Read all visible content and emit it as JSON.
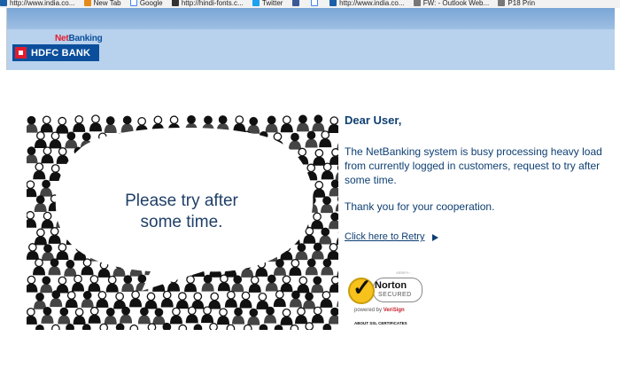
{
  "bookmarks": [
    {
      "label": "http://www.india.co...",
      "icon": "linkedin-icon"
    },
    {
      "label": "New Tab",
      "icon": "new-tab-icon"
    },
    {
      "label": "Google",
      "icon": "google-icon"
    },
    {
      "label": "http://hindi-fonts.c...",
      "icon": "hindi-fonts-icon"
    },
    {
      "label": "Twitter",
      "icon": "twitter-icon"
    },
    {
      "label": "",
      "icon": "facebook-icon"
    },
    {
      "label": "",
      "icon": "google-icon"
    },
    {
      "label": "http://www.india.co...",
      "icon": "linkedin-icon"
    },
    {
      "label": "FW: - Outlook Web...",
      "icon": "outlook-icon"
    },
    {
      "label": "P18 Prin",
      "icon": "globe-icon"
    }
  ],
  "header": {
    "brand_net": "Net",
    "brand_banking": "Banking",
    "brand_name": "HDFC BANK"
  },
  "image": {
    "message": "Please try after some time."
  },
  "message": {
    "greeting": "Dear User,",
    "body": "The NetBanking system is busy processing heavy load from currently logged in customers, request to try after some time.",
    "thanks": "Thank you for your cooperation.",
    "retry_link": "Click here to Retry"
  },
  "norton": {
    "verify": "VERIFY›",
    "name": "Norton",
    "secured": "SECURED",
    "powered_by": "powered by",
    "verisign": "VeriSign",
    "about": "ABOUT SSL CERTIFICATES"
  },
  "colors": {
    "text_blue": "#0e3f73",
    "header_blue": "#b8d1ed",
    "hdfc_blue": "#0b4f9c",
    "hdfc_red": "#e21b2f"
  }
}
